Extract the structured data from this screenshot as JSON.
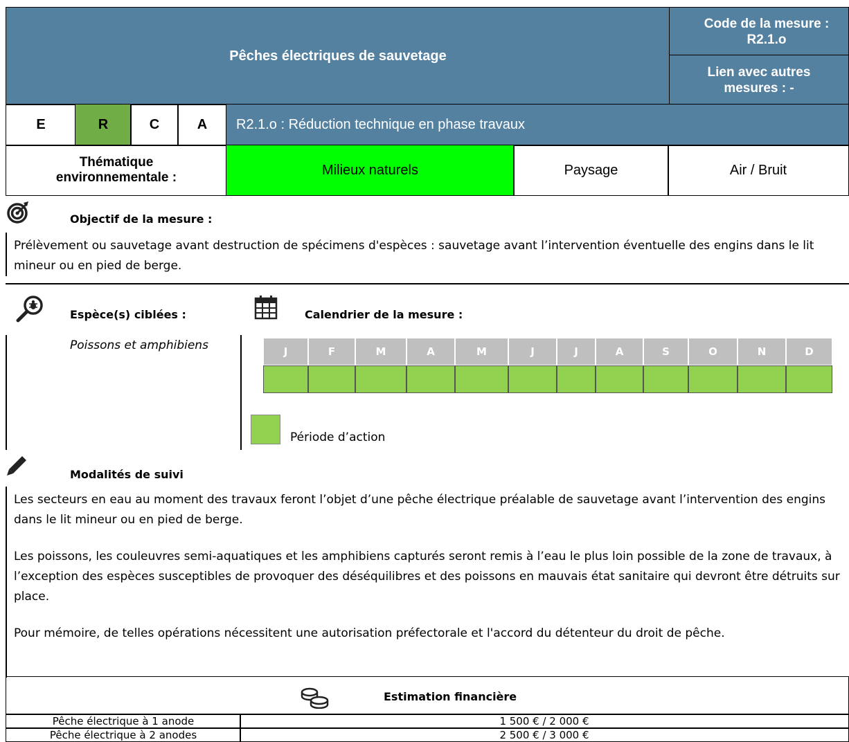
{
  "header": {
    "title": "Pêches électriques de sauvetage",
    "code_label": "Code de la mesure : R2.1.o",
    "link_label": "Lien avec autres mesures : -"
  },
  "erca": {
    "letters": [
      "E",
      "R",
      "C",
      "A"
    ],
    "active": "R",
    "description": "R2.1.o : Réduction technique en phase travaux"
  },
  "thematique": {
    "label": "Thématique environnementale :",
    "options": [
      "Milieux naturels",
      "Paysage",
      "Air / Bruit"
    ],
    "active": "Milieux naturels"
  },
  "objectif": {
    "title": "Objectif de la mesure :",
    "text": "Prélèvement ou sauvetage avant destruction de spécimens d'espèces : sauvetage avant l’intervention éventuelle des engins dans le lit mineur ou en pied de berge."
  },
  "especes": {
    "title": "Espèce(s) ciblées :",
    "text": "Poissons et amphibiens"
  },
  "calendrier": {
    "title": "Calendrier de la mesure :",
    "months": [
      "J",
      "F",
      "M",
      "A",
      "M",
      "J",
      "J",
      "A",
      "S",
      "O",
      "N",
      "D"
    ],
    "legend": "Période d’action"
  },
  "modalites": {
    "title": "Modalités de suivi",
    "paragraphs": [
      "Les secteurs en eau au moment des travaux feront l’objet d’une pêche électrique préalable de sauvetage avant l’intervention des engins dans le lit mineur ou en pied de berge.",
      "Les poissons, les couleuvres semi-aquatiques et les amphibiens capturés seront remis à l’eau le plus loin possible de la zone de travaux, à l’exception des espèces susceptibles de provoquer des déséquilibres et des poissons en mauvais état sanitaire qui devront être détruits sur place.",
      "Pour mémoire, de telles opérations nécessitent une autorisation préfectorale et l'accord du détenteur du droit de pêche."
    ]
  },
  "estimation": {
    "title": "Estimation financière",
    "rows": [
      {
        "label": "Pêche électrique à 1 anode",
        "value": "1 500 € / 2 000 €"
      },
      {
        "label": "Pêche électrique à 2 anodes",
        "value": "2 500 € / 3 000 €"
      }
    ]
  },
  "colors": {
    "header_blue": "#5581a0",
    "active_green_erca": "#70ad47",
    "active_green_theme": "#00ff00",
    "calendar_green": "#92d050",
    "calendar_grey": "#bfbfbf"
  }
}
